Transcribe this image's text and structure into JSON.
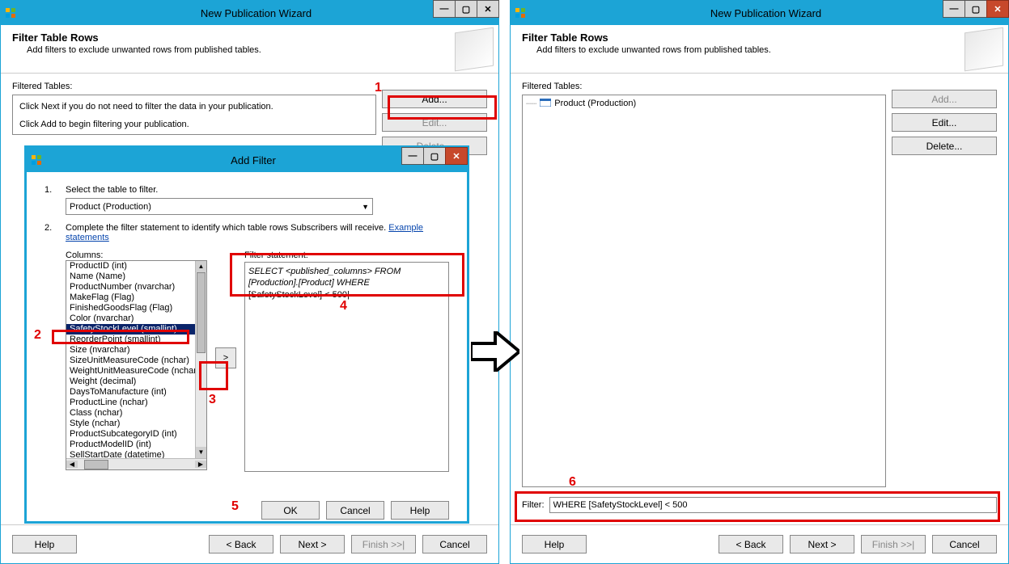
{
  "left_window": {
    "title": "New Publication Wizard",
    "header_title": "Filter Table Rows",
    "header_sub": "Add filters to exclude unwanted rows from published tables.",
    "filtered_tables_label": "Filtered Tables:",
    "instruction1": "Click Next if you do not need to filter the data in your publication.",
    "instruction2": "Click Add to begin filtering your publication.",
    "add_btn": "Add...",
    "edit_btn": "Edit...",
    "delete_btn": "Delete...",
    "help_btn": "Help",
    "back_btn": "< Back",
    "next_btn": "Next >",
    "finish_btn": "Finish >>|",
    "cancel_btn": "Cancel"
  },
  "right_window": {
    "title": "New Publication Wizard",
    "header_title": "Filter Table Rows",
    "header_sub": "Add filters to exclude unwanted rows from published tables.",
    "filtered_tables_label": "Filtered Tables:",
    "tree_item": "Product (Production)",
    "add_btn": "Add...",
    "edit_btn": "Edit...",
    "delete_btn": "Delete...",
    "filter_label": "Filter:",
    "filter_value": "WHERE [SafetyStockLevel] < 500",
    "help_btn": "Help",
    "back_btn": "< Back",
    "next_btn": "Next >",
    "finish_btn": "Finish >>|",
    "cancel_btn": "Cancel"
  },
  "add_filter": {
    "title": "Add Filter",
    "step1_label": "Select the table to filter.",
    "table_select": "Product (Production)",
    "step2_label": "Complete the filter statement to identify which table rows Subscribers will receive. ",
    "example_link": "Example statements",
    "columns_label": "Columns:",
    "filter_stmt_label": "Filter statement:",
    "stmt_line1": "SELECT <published_columns> FROM [Production].[Product] WHERE ",
    "stmt_line2": "[SafetyStockLevel] < 500",
    "columns": [
      "ProductID (int)",
      "Name (Name)",
      "ProductNumber (nvarchar)",
      "MakeFlag (Flag)",
      "FinishedGoodsFlag (Flag)",
      "Color (nvarchar)",
      "SafetyStockLevel (smallint)",
      "ReorderPoint (smallint)",
      "Size (nvarchar)",
      "SizeUnitMeasureCode (nchar)",
      "WeightUnitMeasureCode (nchar)",
      "Weight (decimal)",
      "DaysToManufacture (int)",
      "ProductLine (nchar)",
      "Class (nchar)",
      "Style (nchar)",
      "ProductSubcategoryID (int)",
      "ProductModelID (int)",
      "SellStartDate (datetime)"
    ],
    "selected_column_index": 6,
    "ok_btn": "OK",
    "cancel_btn": "Cancel",
    "help_btn": "Help"
  },
  "annotations": {
    "n1": "1",
    "n2": "2",
    "n3": "3",
    "n4": "4",
    "n5": "5",
    "n6": "6"
  }
}
